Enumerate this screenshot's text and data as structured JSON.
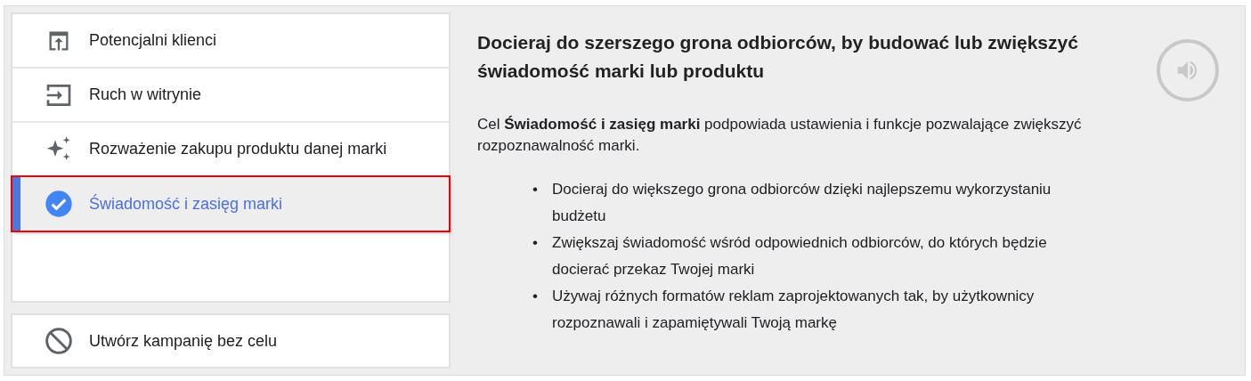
{
  "goals": [
    {
      "label": "Potencjalni klienci",
      "selected": false
    },
    {
      "label": "Ruch w witrynie",
      "selected": false
    },
    {
      "label": "Rozważenie zakupu produktu danej marki",
      "selected": false
    },
    {
      "label": "Świadomość i zasięg marki",
      "selected": true
    }
  ],
  "no_goal": {
    "label": "Utwórz kampanię bez celu"
  },
  "detail": {
    "heading": "Docieraj do szerszego grona odbiorców, by budować lub zwiększyć świadomość marki lub produktu",
    "intro": "Cel **Świadomość i zasięg marki** podpowiada ustawienia i funkcje pozwalające zwiększyć rozpoznawalność marki.",
    "bullets": [
      {
        "marker": "•",
        "text": "Docieraj do większego grona odbiorców dzięki najlepszemu wykorzystaniu budżetu"
      },
      {
        "marker": "•",
        "text": "Zwiększaj świadomość wśród odpowiednich odbiorców, do których będzie docierać przekaz Twojej marki"
      },
      {
        "marker": "•",
        "text": "Używaj różnych formatów reklam zaprojektowanych tak, by użytkownicy rozpoznawali i zapamiętywali Twoją markę"
      }
    ]
  }
}
